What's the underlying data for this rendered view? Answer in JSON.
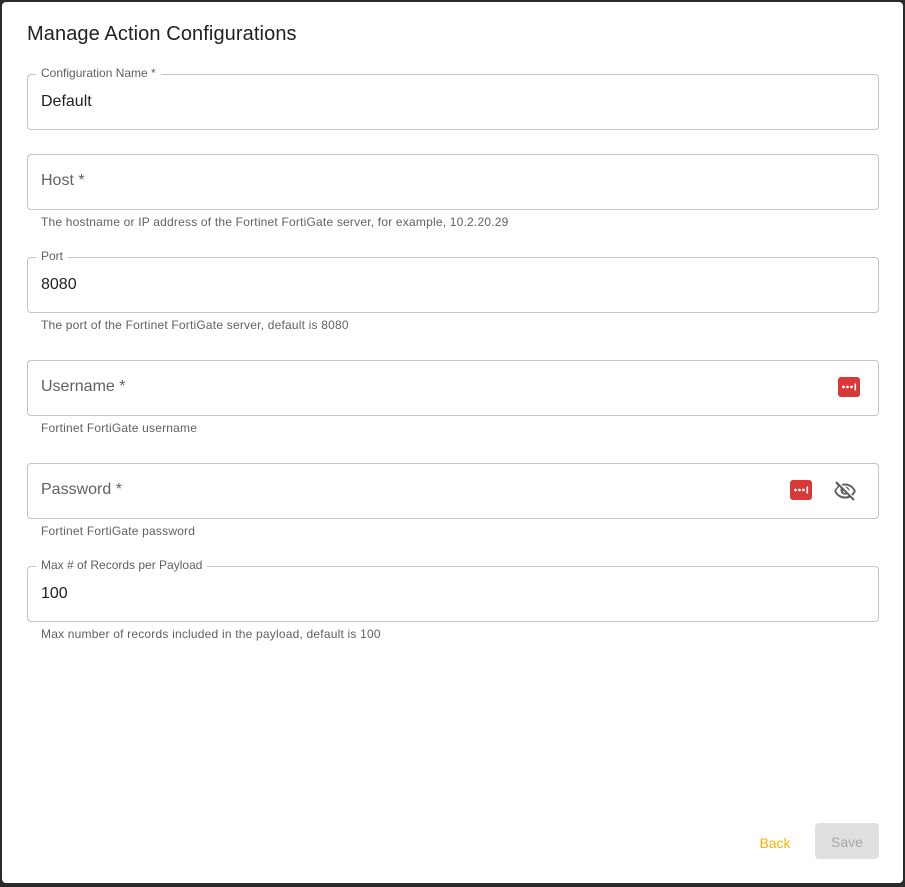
{
  "dialog": {
    "title": "Manage Action Configurations"
  },
  "fields": {
    "config_name": {
      "label": "Configuration Name *",
      "value": "Default"
    },
    "host": {
      "label": "Host *",
      "value": "",
      "helper": "The hostname or IP address of the Fortinet FortiGate server, for example, 10.2.20.29"
    },
    "port": {
      "label": "Port",
      "value": "8080",
      "helper": "The port of the Fortinet FortiGate server, default is 8080"
    },
    "username": {
      "label": "Username *",
      "value": "",
      "helper": "Fortinet FortiGate username",
      "icon": "password-manager-icon"
    },
    "password": {
      "label": "Password *",
      "value": "",
      "helper": "Fortinet FortiGate password",
      "icons": [
        "password-manager-icon",
        "eye-off-icon"
      ]
    },
    "max_records": {
      "label": "Max # of Records per Payload",
      "value": "100",
      "helper": "Max number of records included in the payload, default is 100"
    }
  },
  "actions": {
    "back_label": "Back",
    "save_label": "Save"
  },
  "colors": {
    "accent": "#f5b400",
    "password_manager": "#d93838",
    "disabled_bg": "#e0e0e0",
    "disabled_text": "#a6a6a6",
    "outline": "#c4c4c4"
  }
}
